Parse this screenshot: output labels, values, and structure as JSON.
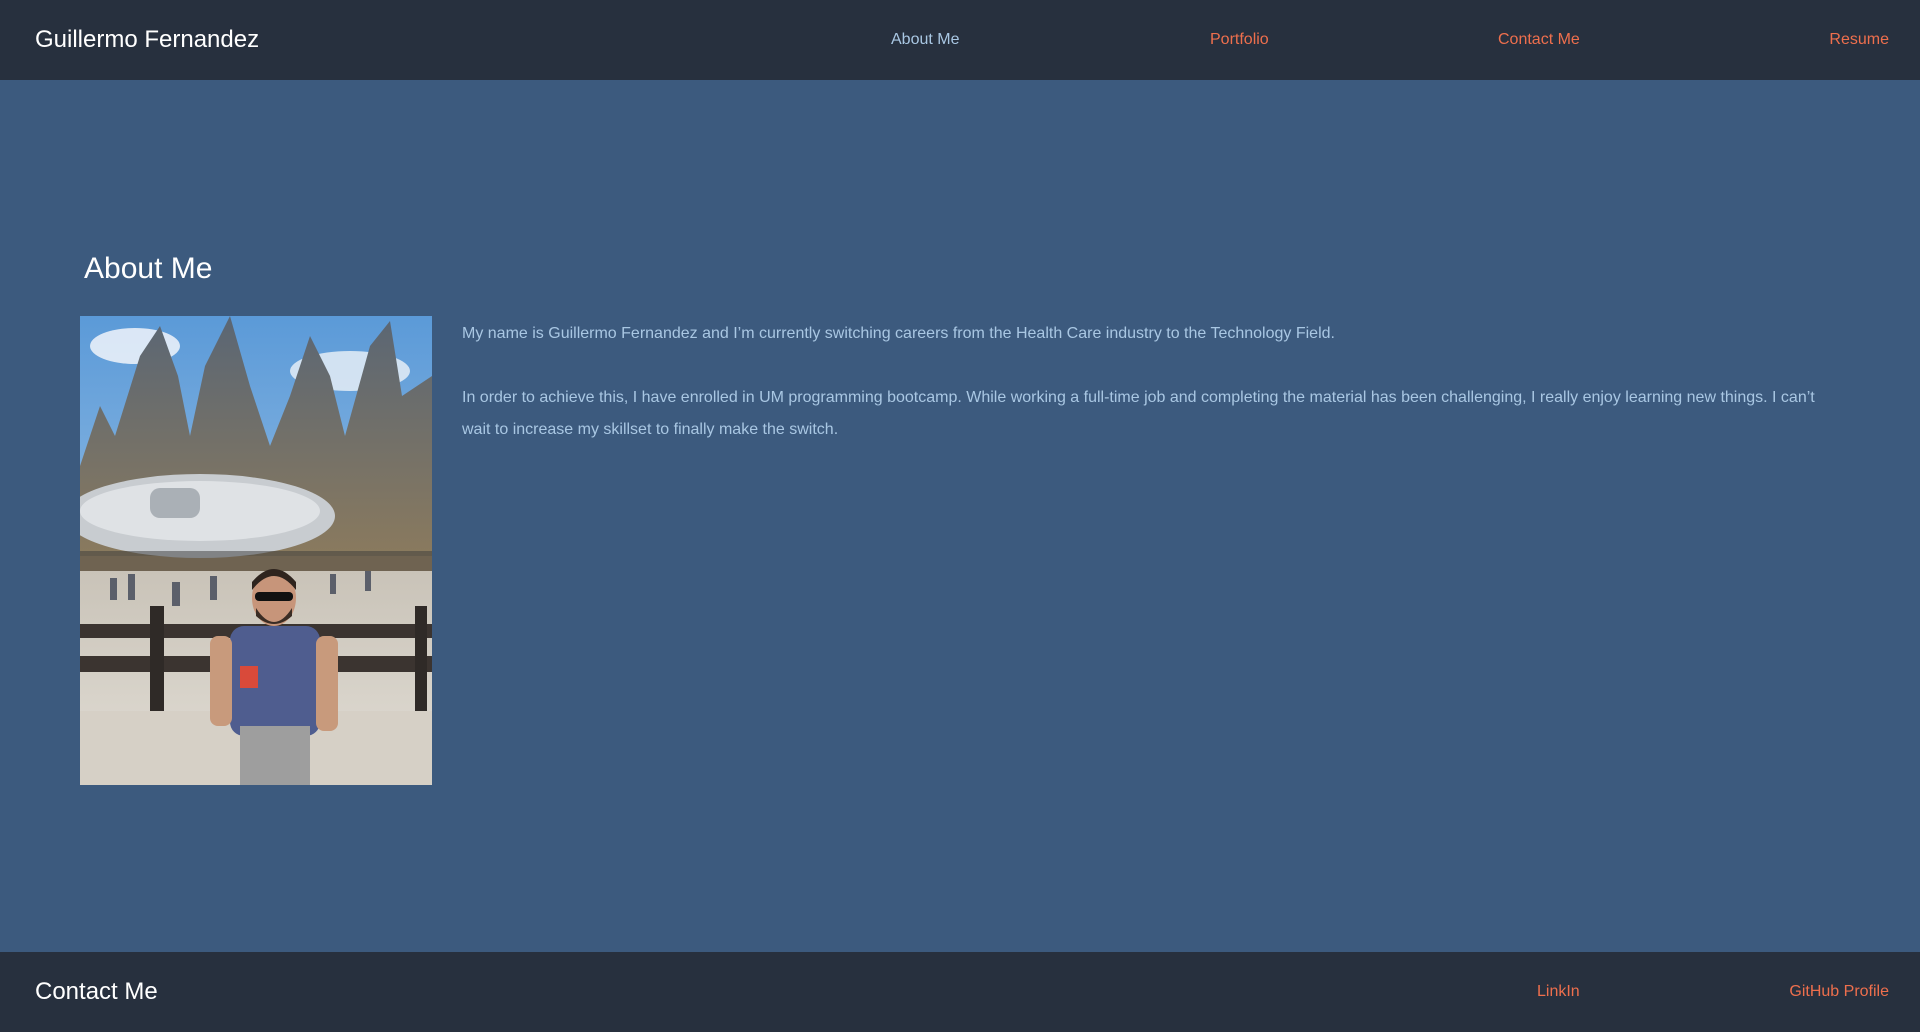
{
  "header": {
    "brand": "Guillermo Fernandez",
    "nav": {
      "about": "About Me",
      "portfolio": "Portfolio",
      "contact": "Contact Me",
      "resume": "Resume"
    }
  },
  "main": {
    "title": "About Me",
    "paragraphs": [
      "My name is Guillermo Fernandez and I’m currently switching careers from the Health Care industry to the Technology Field.",
      "In order to achieve this, I have enrolled in UM programming bootcamp. While working a full-time job and completing the material has been challenging, I really enjoy learning new things. I can’t wait to increase my skillset to finally make the switch."
    ]
  },
  "footer": {
    "title": "Contact Me",
    "links": {
      "linkedin": "LinkIn",
      "github": "GitHub Profile"
    }
  },
  "colors": {
    "page_background": "#3c5a7e",
    "bar_background": "#27303e",
    "link": "#ee6f4d",
    "active_link": "#a9c7e3",
    "heading": "#ffffff"
  }
}
